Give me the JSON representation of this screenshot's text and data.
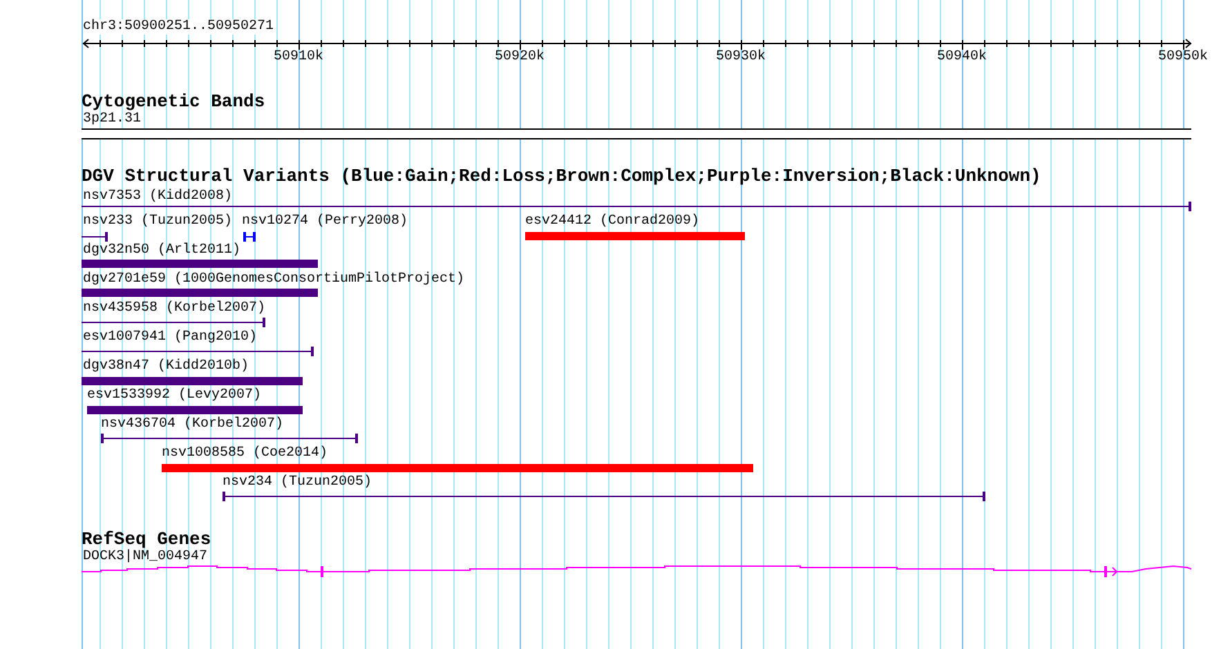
{
  "ruler": {
    "location": "chr3:50900251..50950271",
    "ticks": [
      "50910k",
      "50920k",
      "50930k",
      "50940k",
      "50950k"
    ]
  },
  "cytogenetic_bands": {
    "title": "Cytogenetic Bands",
    "band": "3p21.31"
  },
  "dgv_variants": {
    "title": "DGV Structural Variants (Blue:Gain;Red:Loss;Brown:Complex;Purple:Inversion;Black:Unknown)",
    "features": [
      {
        "label": "nsv7353 (Kidd2008)",
        "kind": "line",
        "color": "#4b0082"
      },
      {
        "label": "nsv233 (Tuzun2005)",
        "kind": "line",
        "color": "#4b0082"
      },
      {
        "label": "nsv10274 (Perry2008)",
        "kind": "line",
        "color": "#0000ff"
      },
      {
        "label": "esv24412 (Conrad2009)",
        "kind": "bar",
        "color": "#ff0000"
      },
      {
        "label": "dgv32n50 (Arlt2011)",
        "kind": "bar",
        "color": "#4b0082"
      },
      {
        "label": "dgv2701e59 (1000GenomesConsortiumPilotProject)",
        "kind": "bar",
        "color": "#4b0082"
      },
      {
        "label": "nsv435958 (Korbel2007)",
        "kind": "line",
        "color": "#4b0082"
      },
      {
        "label": "esv1007941 (Pang2010)",
        "kind": "line",
        "color": "#4b0082"
      },
      {
        "label": "dgv38n47 (Kidd2010b)",
        "kind": "bar",
        "color": "#4b0082"
      },
      {
        "label": "esv1533992 (Levy2007)",
        "kind": "bar",
        "color": "#4b0082"
      },
      {
        "label": "nsv436704 (Korbel2007)",
        "kind": "line",
        "color": "#4b0082"
      },
      {
        "label": "nsv1008585 (Coe2014)",
        "kind": "bar",
        "color": "#ff0000"
      },
      {
        "label": "nsv234 (Tuzun2005)",
        "kind": "line",
        "color": "#4b0082"
      }
    ]
  },
  "refseq_genes": {
    "title": "RefSeq Genes",
    "gene": "DOCK3|NM_004947"
  }
}
